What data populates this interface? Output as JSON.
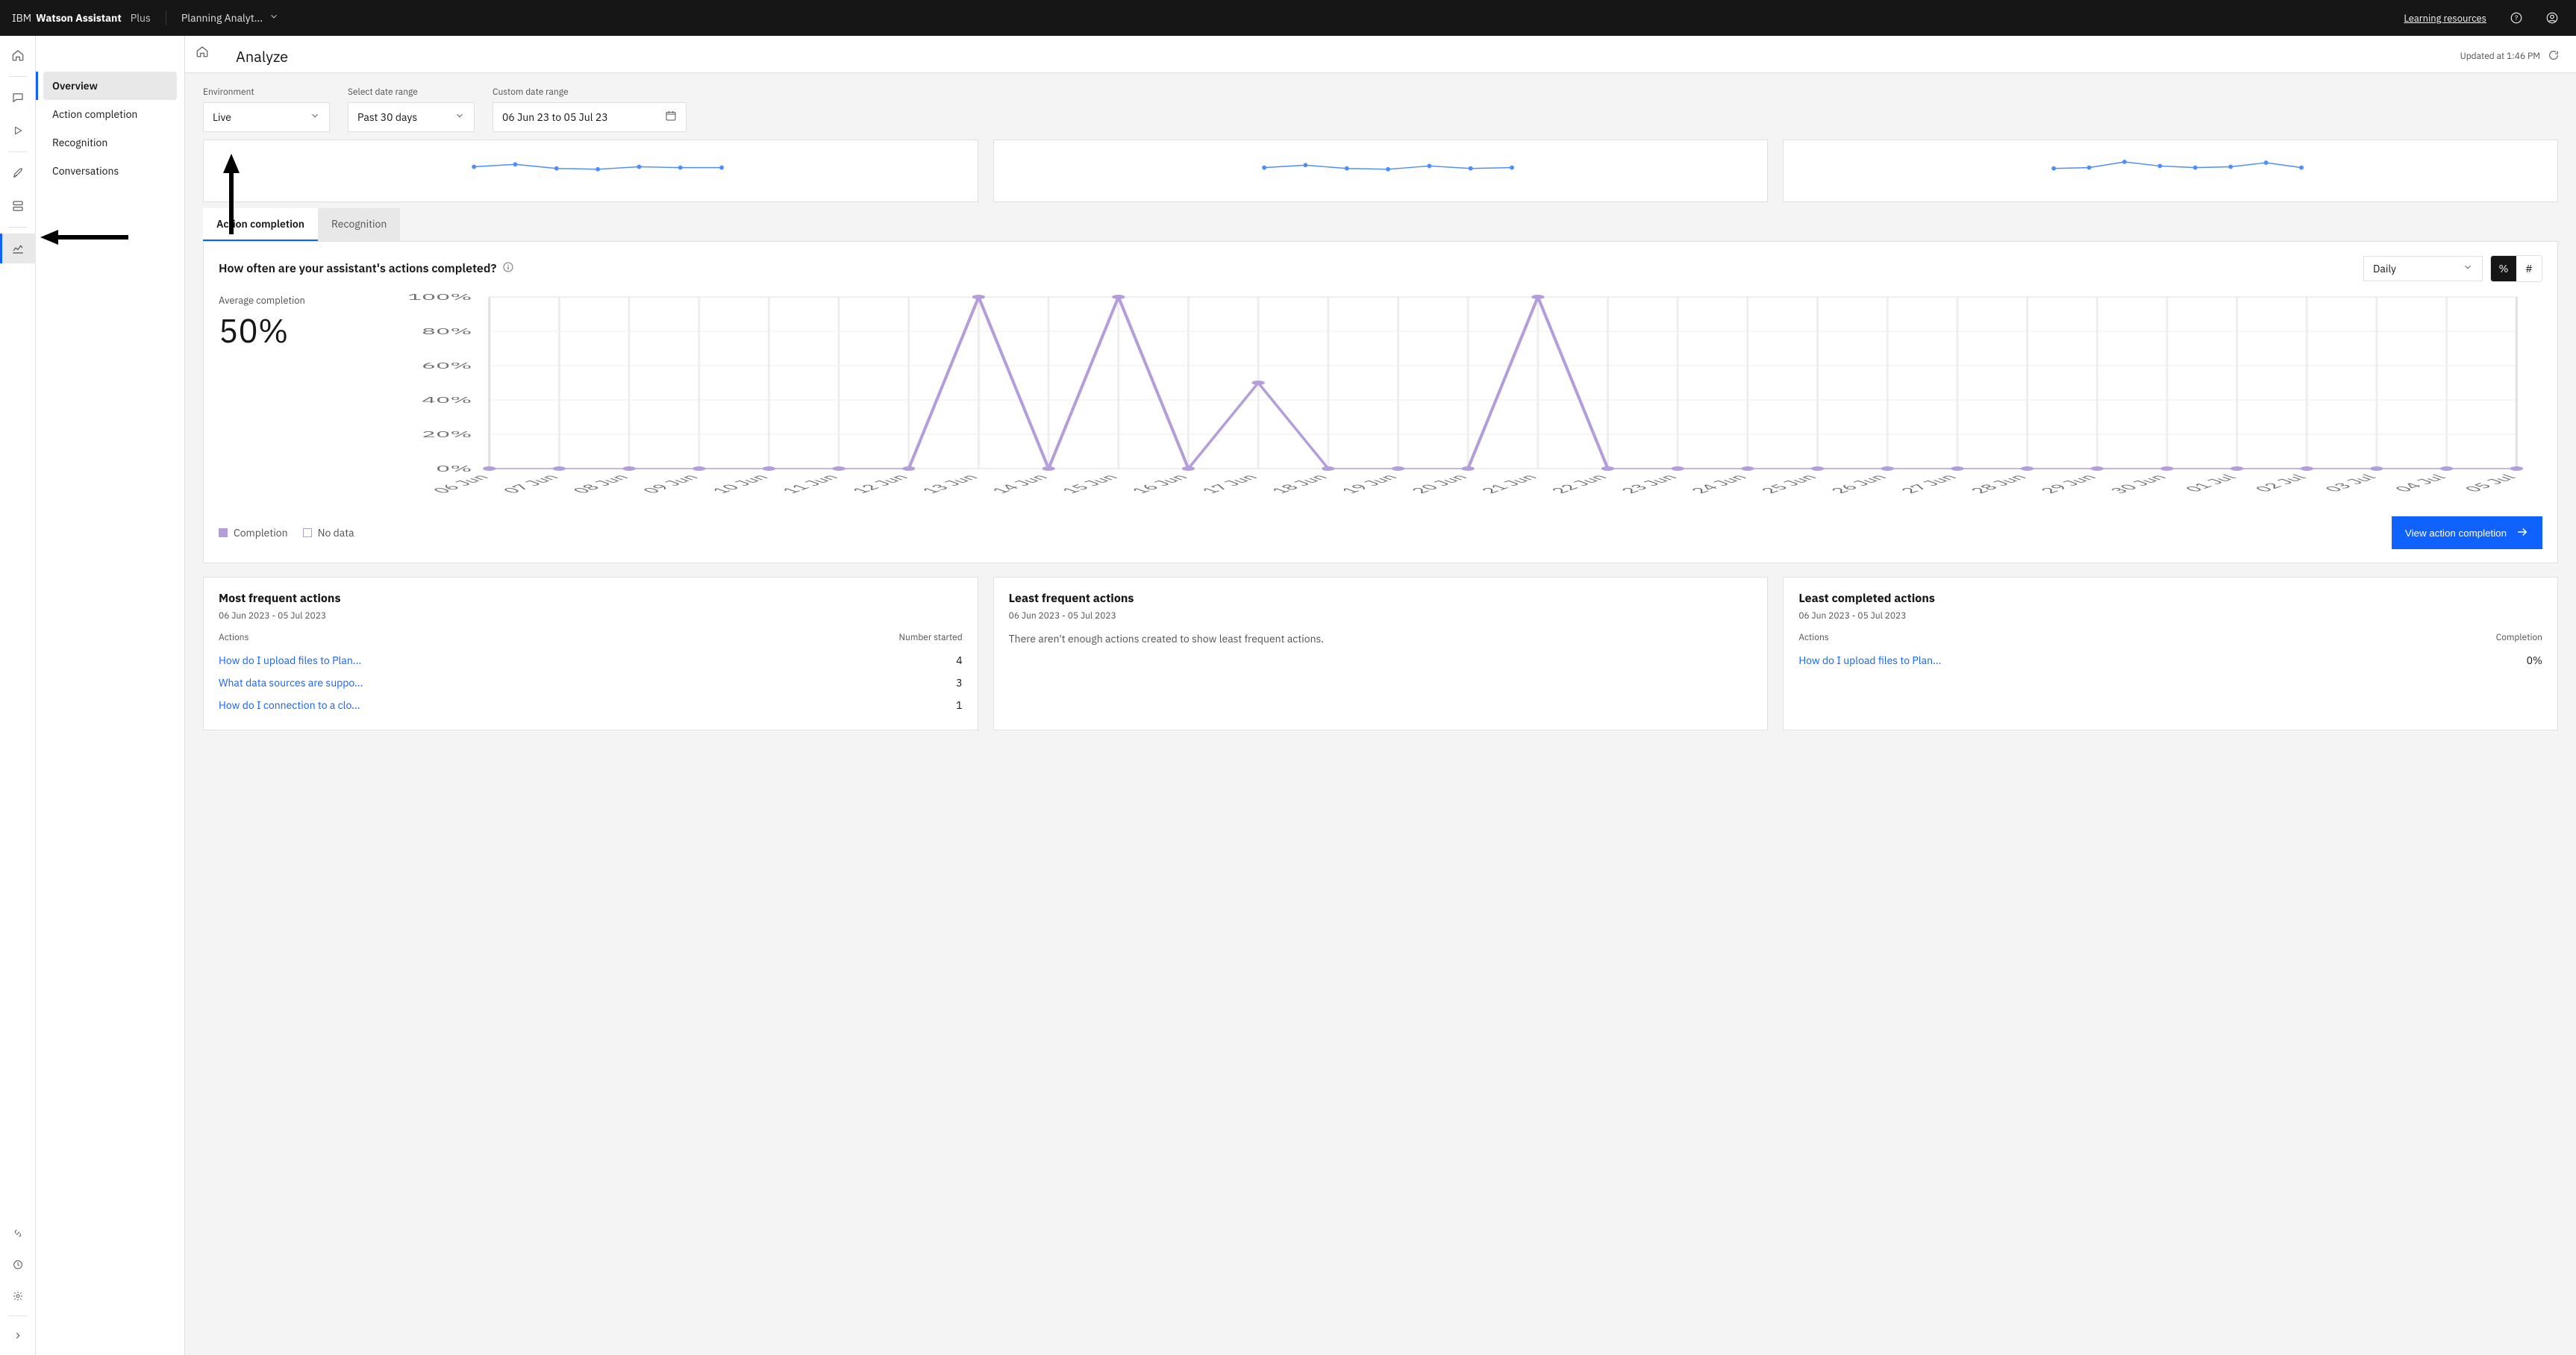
{
  "appbar": {
    "ibm": "IBM",
    "product": "Watson Assistant",
    "tier": "Plus",
    "assistant": "Planning Analyt...",
    "learning": "Learning resources"
  },
  "page": {
    "title": "Analyze",
    "updated": "Updated at 1:46 PM"
  },
  "subnav": {
    "items": [
      "Overview",
      "Action completion",
      "Recognition",
      "Conversations"
    ],
    "activeIndex": 0
  },
  "filters": {
    "env_label": "Environment",
    "env_value": "Live",
    "range_label": "Select date range",
    "range_value": "Past 30 days",
    "custom_label": "Custom date range",
    "custom_value": "06 Jun 23 to 05 Jul 23"
  },
  "tabs": {
    "a": "Action completion",
    "b": "Recognition",
    "activeIndex": 0
  },
  "chart": {
    "title": "How often are your assistant's actions completed?",
    "granularity": "Daily",
    "unit_percent": "%",
    "unit_count": "#",
    "avg_label": "Average completion",
    "avg_value": "50%",
    "legend_completion": "Completion",
    "legend_nodata": "No data",
    "cta": "View action completion"
  },
  "grid": {
    "most_title": "Most frequent actions",
    "least_title": "Least frequent actions",
    "comp_title": "Least completed actions",
    "range": "06 Jun 2023 - 05 Jul 2023",
    "actions_col": "Actions",
    "started_col": "Number started",
    "completion_col": "Completion",
    "empty_least": "There aren't enough actions created to show least frequent actions.",
    "most_rows": [
      {
        "action": "How do I upload files to Plan...",
        "value": "4"
      },
      {
        "action": "What data sources are suppo...",
        "value": "3"
      },
      {
        "action": "How do I connection to a clo...",
        "value": "1"
      }
    ],
    "comp_rows": [
      {
        "action": "How do I upload files to Plan...",
        "value": "0%"
      }
    ]
  },
  "chart_data": {
    "type": "line",
    "title": "How often are your assistant's actions completed?",
    "xlabel": "",
    "ylabel": "",
    "ylim": [
      0,
      100
    ],
    "y_ticks": [
      "0%",
      "20%",
      "40%",
      "60%",
      "80%",
      "100%"
    ],
    "categories": [
      "06 Jun",
      "07 Jun",
      "08 Jun",
      "09 Jun",
      "10 Jun",
      "11 Jun",
      "12 Jun",
      "13 Jun",
      "14 Jun",
      "15 Jun",
      "16 Jun",
      "17 Jun",
      "18 Jun",
      "19 Jun",
      "20 Jun",
      "21 Jun",
      "22 Jun",
      "23 Jun",
      "24 Jun",
      "25 Jun",
      "26 Jun",
      "27 Jun",
      "28 Jun",
      "29 Jun",
      "30 Jun",
      "01 Jul",
      "02 Jul",
      "03 Jul",
      "04 Jul",
      "05 Jul"
    ],
    "series": [
      {
        "name": "Completion",
        "values": [
          0,
          0,
          0,
          0,
          0,
          0,
          0,
          100,
          0,
          100,
          0,
          50,
          0,
          0,
          0,
          100,
          0,
          0,
          0,
          0,
          0,
          0,
          0,
          0,
          0,
          0,
          0,
          0,
          0,
          0
        ]
      }
    ],
    "legend": [
      "Completion",
      "No data"
    ],
    "average": 50,
    "mini": {
      "type": "sparkline",
      "x_count": 7,
      "series": [
        [
          60,
          66,
          56,
          54,
          60,
          58,
          58
        ],
        [
          58,
          64,
          56,
          54,
          62,
          56,
          58
        ],
        [
          56,
          58,
          72,
          62,
          58,
          60,
          70,
          58
        ]
      ]
    }
  }
}
